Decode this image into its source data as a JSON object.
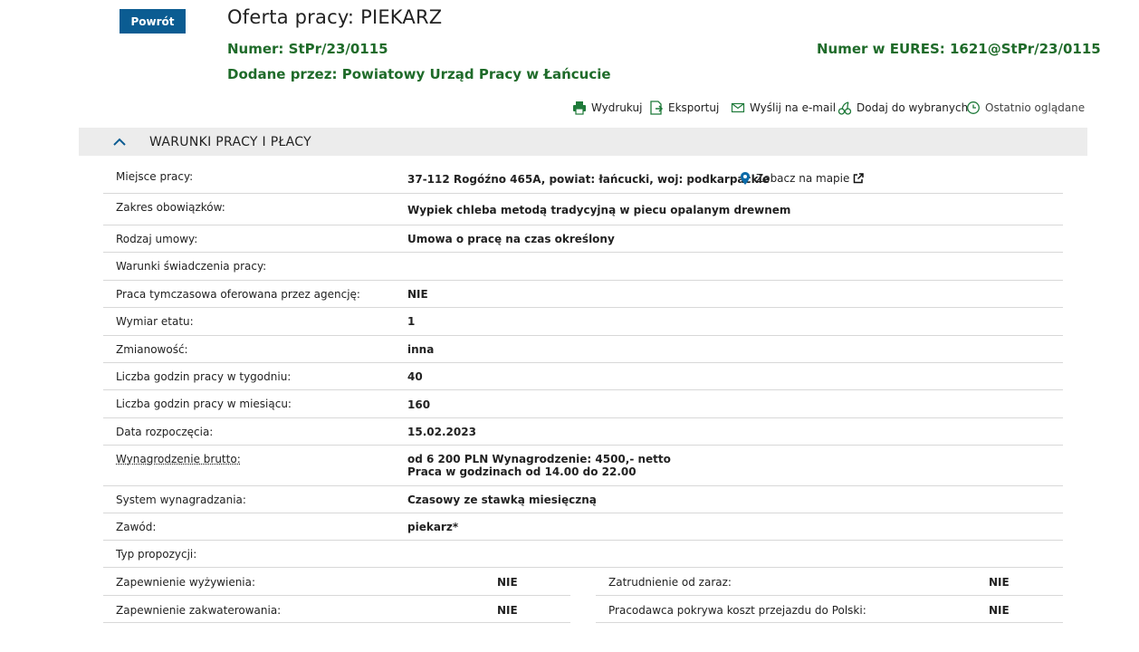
{
  "header": {
    "back_label": "Powrót",
    "title": "Oferta pracy: PIEKARZ",
    "numer_label": "Numer:",
    "numer_value": "StPr/23/0115",
    "eures_label": "Numer w EURES:",
    "eures_value": "1621@StPr/23/0115",
    "added_label": "Dodane przez:",
    "added_value": "Powiatowy Urząd Pracy w Łańcucie"
  },
  "actions": [
    {
      "label": "Wydrukuj",
      "icon": "printer-icon"
    },
    {
      "label": "Eksportuj",
      "icon": "export-icon"
    },
    {
      "label": "Wyślij na e-mail",
      "icon": "envelope-icon"
    },
    {
      "label": "Dodaj do wybranych",
      "icon": "cherries-icon"
    },
    {
      "label": "Ostatnio oglądane",
      "icon": "clock-icon"
    }
  ],
  "section": {
    "title": "WARUNKI PRACY I PŁACY",
    "state": "expanded"
  },
  "colors": {
    "primary_button": "#0b5c92",
    "green_text": "#1f6b2a",
    "section_bg": "#ececec"
  },
  "rows": [
    {
      "label": "Miejsce pracy:",
      "value": "37-112 Rogóźno 465A, powiat: łańcucki, woj: podkarpackie",
      "map_link": "Zobacz na mapie"
    },
    {
      "label": "Zakres obowiązków:",
      "value": "Wypiek chleba metodą tradycyjną w piecu opalanym drewnem"
    },
    {
      "label": "Rodzaj umowy:",
      "value": "Umowa o pracę na czas określony"
    },
    {
      "label": "Warunki świadczenia pracy:",
      "value": ""
    },
    {
      "label": "Praca tymczasowa oferowana przez agencję:",
      "value": "NIE"
    },
    {
      "label": "Wymiar etatu:",
      "value": "1"
    },
    {
      "label": "Zmianowość:",
      "value": "inna"
    },
    {
      "label": "Liczba godzin pracy w tygodniu:",
      "value": "40"
    },
    {
      "label": "Liczba godzin pracy w miesiącu:",
      "value": "160"
    },
    {
      "label": "Data rozpoczęcia:",
      "value": "15.02.2023"
    },
    {
      "label": "Wynagrodzenie brutto:",
      "value_line1": "od 6 200 PLN Wynagrodzenie: 4500,- netto",
      "value_line2": "Praca w godzinach od 14.00 do 22.00"
    },
    {
      "label": "System wynagradzania:",
      "value": "Czasowy ze stawką miesięczną"
    },
    {
      "label": "Zawód:",
      "value": "piekarz*"
    },
    {
      "label": "Typ propozycji:",
      "value": ""
    }
  ],
  "half_rows": {
    "left": [
      {
        "label": "Zapewnienie wyżywienia:",
        "value": "NIE"
      },
      {
        "label": "Zapewnienie zakwaterowania:",
        "value": "NIE"
      }
    ],
    "right": [
      {
        "label": "Zatrudnienie od zaraz:",
        "value": "NIE"
      },
      {
        "label": "Pracodawca pokrywa koszt przejazdu do Polski:",
        "value": "NIE"
      }
    ]
  }
}
